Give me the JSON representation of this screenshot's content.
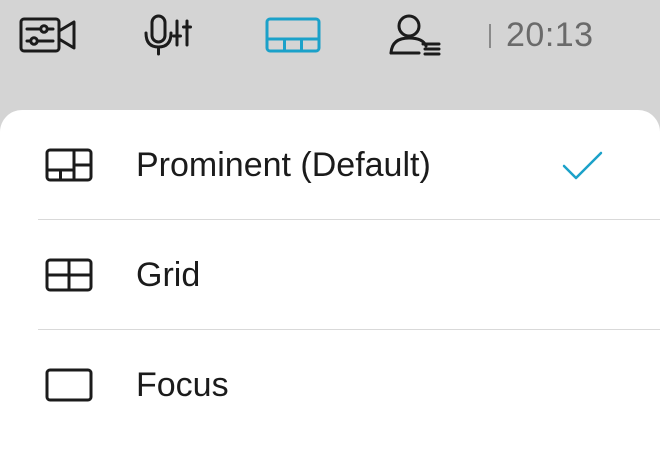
{
  "toolbar": {
    "icons": [
      {
        "name": "camera-settings-icon",
        "active": false
      },
      {
        "name": "microphone-settings-icon",
        "active": false
      },
      {
        "name": "layout-icon",
        "active": true
      },
      {
        "name": "participants-icon",
        "active": false
      }
    ],
    "clock": "20:13",
    "active_color": "#1ba1c9",
    "icon_color": "#1b1b1b"
  },
  "layout_menu": {
    "items": [
      {
        "label": "Prominent (Default)",
        "icon": "prominent-layout-icon",
        "selected": true
      },
      {
        "label": "Grid",
        "icon": "grid-layout-icon",
        "selected": false
      },
      {
        "label": "Focus",
        "icon": "focus-layout-icon",
        "selected": false
      }
    ],
    "check_color": "#1ba1c9"
  }
}
